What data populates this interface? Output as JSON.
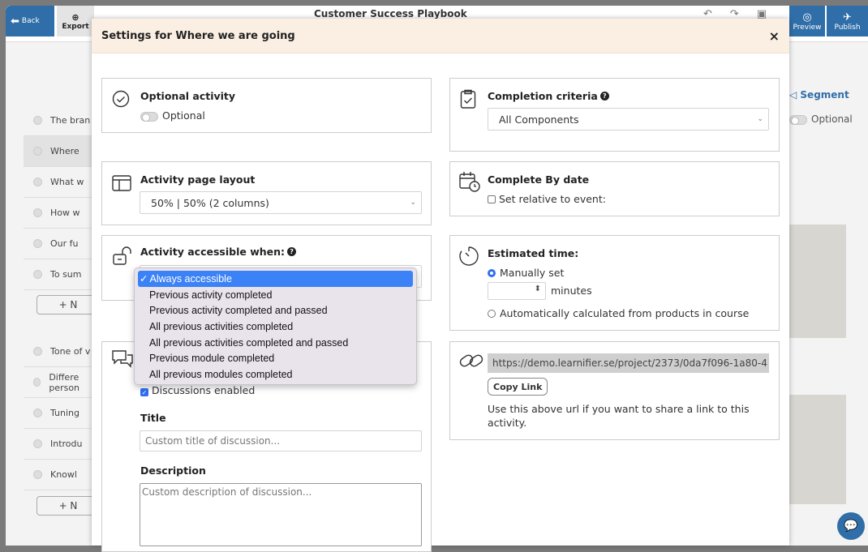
{
  "topbar": {
    "back_label": "Back",
    "export_label": "Export",
    "title": "Customer Success Playbook",
    "preview_label": "Preview",
    "publish_label": "Publish"
  },
  "outline": {
    "rows": [
      "The bran",
      "Where",
      "What w",
      "How w",
      "Our fu",
      "To sum"
    ],
    "add_label": "+ N",
    "rows2": [
      "Tone of v",
      "Differe person",
      "Tuning",
      "Introdu",
      "Knowl"
    ],
    "add_label2": "+ N"
  },
  "right_bg": {
    "segment_label": "Segment",
    "optional_label": "Optional"
  },
  "modal": {
    "title": "Settings for Where we are going",
    "close": "×",
    "optional": {
      "title": "Optional activity",
      "toggle_label": "Optional"
    },
    "layout": {
      "title": "Activity page layout",
      "value": "50% | 50% (2 columns)"
    },
    "accessible": {
      "title": "Activity accessible when:",
      "options": [
        "Always accessible",
        "Previous activity completed",
        "Previous activity completed and passed",
        "All previous activities completed",
        "All previous activities completed and passed",
        "Previous module completed",
        "All previous modules completed"
      ],
      "selected_mark": "✓"
    },
    "discussion": {
      "enabled_label": "Discussions enabled",
      "title_label": "Title",
      "title_placeholder": "Custom title of discussion...",
      "desc_label": "Description",
      "desc_placeholder": "Custom description of discussion..."
    },
    "completion": {
      "title": "Completion criteria",
      "value": "All Components"
    },
    "complete_by": {
      "title": "Complete By date",
      "relative_label": "Set relative to event:"
    },
    "estimated": {
      "title": "Estimated time:",
      "manual_label": "Manually set",
      "minutes_label": "minutes",
      "auto_label": "Automatically calculated from products in course"
    },
    "link": {
      "url": "https://demo.learnifier.se/project/2373/0da7f096-1a80-4",
      "copy_label": "Copy Link",
      "help_text": "Use this above url if you want to share a link to this activity."
    }
  },
  "colors": {
    "accent": "#2f6ea8",
    "modal_header": "#fbefe3",
    "selected": "#3b82f6"
  }
}
